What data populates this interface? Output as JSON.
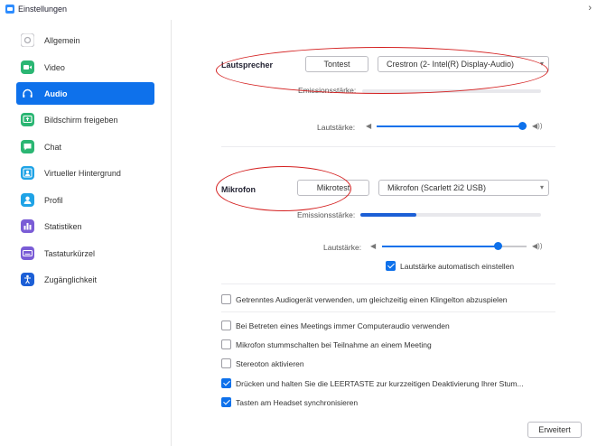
{
  "window": {
    "title": "Einstellungen",
    "close_glyph": "›"
  },
  "sidebar": {
    "items": [
      {
        "label": "Allgemein",
        "icon": "gear-icon",
        "color": "#d8d8dc"
      },
      {
        "label": "Video",
        "icon": "video-icon",
        "color": "#2bb673"
      },
      {
        "label": "Audio",
        "icon": "headphones-icon",
        "color": "#0e71eb",
        "active": true
      },
      {
        "label": "Bildschirm freigeben",
        "icon": "share-screen-icon",
        "color": "#2bb673"
      },
      {
        "label": "Chat",
        "icon": "chat-icon",
        "color": "#2bb673"
      },
      {
        "label": "Virtueller Hintergrund",
        "icon": "person-background-icon",
        "color": "#1fa3e6"
      },
      {
        "label": "Profil",
        "icon": "profile-icon",
        "color": "#1fa3e6"
      },
      {
        "label": "Statistiken",
        "icon": "statistics-icon",
        "color": "#7a5cd6"
      },
      {
        "label": "Tastaturkürzel",
        "icon": "keyboard-icon",
        "color": "#7a5cd6"
      },
      {
        "label": "Zugänglichkeit",
        "icon": "accessibility-icon",
        "color": "#1c5fd6"
      }
    ]
  },
  "speaker": {
    "label": "Lautsprecher",
    "test_button": "Tontest",
    "device": "Crestron (2- Intel(R) Display-Audio)",
    "output_level_label": "Emissionsstärke:",
    "output_level": 0,
    "volume_label": "Lautstärke:",
    "volume": 1.0
  },
  "microphone": {
    "label": "Mikrofon",
    "test_button": "Mikrotest",
    "device": "Mikrofon (Scarlett 2i2 USB)",
    "input_level_label": "Emissionsstärke:",
    "input_level": 0.31,
    "volume_label": "Lautstärke:",
    "volume": 0.82,
    "auto_adjust_label": "Lautstärke automatisch einstellen",
    "auto_adjust": true
  },
  "options": [
    {
      "label": "Getrenntes Audiogerät verwenden, um gleichzeitig einen Klingelton abzuspielen",
      "checked": false
    },
    {
      "label": "Bei Betreten eines Meetings immer Computeraudio verwenden",
      "checked": false
    },
    {
      "label": "Mikrofon stummschalten bei Teilnahme an einem Meeting",
      "checked": false
    },
    {
      "label": "Stereoton aktivieren",
      "checked": false
    },
    {
      "label": "Drücken und halten Sie die LEERTASTE zur kurzzeitigen Deaktivierung Ihrer Stum...",
      "checked": true
    },
    {
      "label": "Tasten am Headset synchronisieren",
      "checked": true
    }
  ],
  "advanced_button": "Erweitert",
  "colors": {
    "accent": "#0e71eb",
    "annotation": "#d42020"
  }
}
